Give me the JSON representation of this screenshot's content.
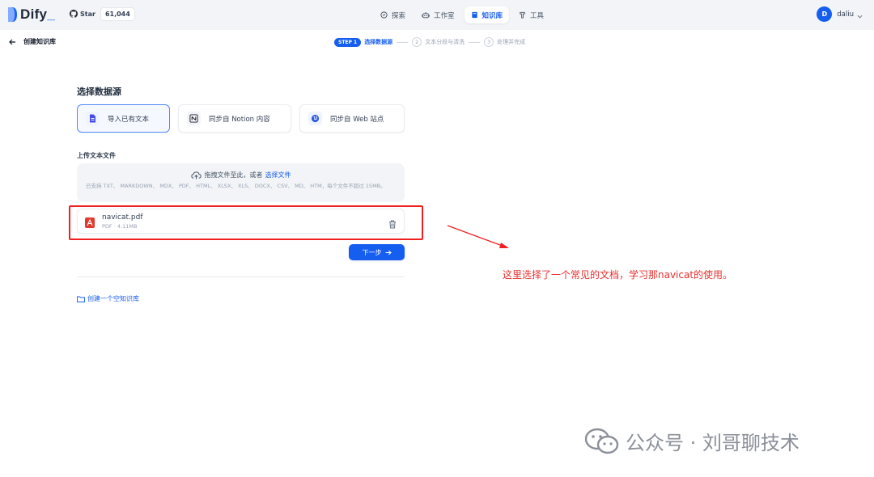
{
  "app": {
    "name": "Dify"
  },
  "github": {
    "star_label": "Star",
    "star_count": "61,044"
  },
  "nav": {
    "items": [
      {
        "label": "探索",
        "icon": "compass-icon",
        "active": false
      },
      {
        "label": "工作室",
        "icon": "robot-icon",
        "active": false
      },
      {
        "label": "知识库",
        "icon": "book-icon",
        "active": true
      },
      {
        "label": "工具",
        "icon": "tools-icon",
        "active": false
      }
    ]
  },
  "user": {
    "initial": "D",
    "name": "daliu"
  },
  "header": {
    "back_label": "创建知识库"
  },
  "steps": {
    "step1_badge": "STEP 1",
    "step1_label": "选择数据源",
    "step2_num": "2",
    "step2_label": "文本分段与清洗",
    "step3_num": "3",
    "step3_label": "处理并完成"
  },
  "data_source": {
    "title": "选择数据源",
    "options": [
      {
        "label": "导入已有文本",
        "icon": "file-icon",
        "selected": true
      },
      {
        "label": "同步自 Notion 内容",
        "icon": "notion-icon",
        "selected": false
      },
      {
        "label": "同步自 Web 站点",
        "icon": "globe-icon",
        "selected": false
      }
    ]
  },
  "upload": {
    "title": "上传文本文件",
    "drop_text": "拖拽文件至此，或者",
    "drop_link": "选择文件",
    "hint": "已支持 TXT、 MARKDOWN、 MDX、 PDF、 HTML、 XLSX、 XLS、 DOCX、 CSV、 MD、 HTM，每个文件不超过 15MB。"
  },
  "file": {
    "name": "navicat.pdf",
    "meta": "PDF · 4.11MB"
  },
  "next_button": {
    "label": "下一步"
  },
  "create_empty": {
    "label": "创建一个空知识库"
  },
  "annotation": {
    "text": "这里选择了一个常见的文档，学习那navicat的使用。",
    "color": "#e8312e"
  },
  "watermark": {
    "text": "公众号 · 刘哥聊技术"
  },
  "colors": {
    "primary": "#155eef",
    "annotation_red": "#f02020"
  }
}
